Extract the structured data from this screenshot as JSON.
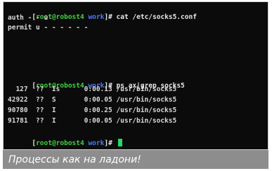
{
  "terminal": {
    "prompt": {
      "open": "[",
      "user_host": "root@robost4",
      "dir": "work",
      "close": "]",
      "symbol": "#"
    },
    "lines": [
      {
        "type": "prompt",
        "command": "cat /etc/socks5.conf"
      },
      {
        "type": "output",
        "text": "auth - - u"
      },
      {
        "type": "output",
        "text": "permit u - - - - - -"
      },
      {
        "type": "blank"
      },
      {
        "type": "blank"
      },
      {
        "type": "blank"
      },
      {
        "type": "prompt",
        "command": "ps ax|grep socks5"
      },
      {
        "type": "output",
        "text": "  127  ??  Is      0:00.13 /usr/bin/socks5"
      },
      {
        "type": "output",
        "text": "42922  ??  S       0:00.05 /usr/bin/socks5"
      },
      {
        "type": "output",
        "text": "90780  ??  I       0:00.25 /usr/bin/socks5"
      },
      {
        "type": "output",
        "text": "91781  ??  I       0:00.05 /usr/bin/socks5"
      },
      {
        "type": "prompt_cursor",
        "command": ""
      }
    ],
    "colors": {
      "background": "#0b0b0b",
      "user": "#3fd13f",
      "dir": "#4a78ff",
      "cursor": "#27d76a"
    }
  },
  "caption": {
    "text": "Процессы как на ладони!"
  }
}
